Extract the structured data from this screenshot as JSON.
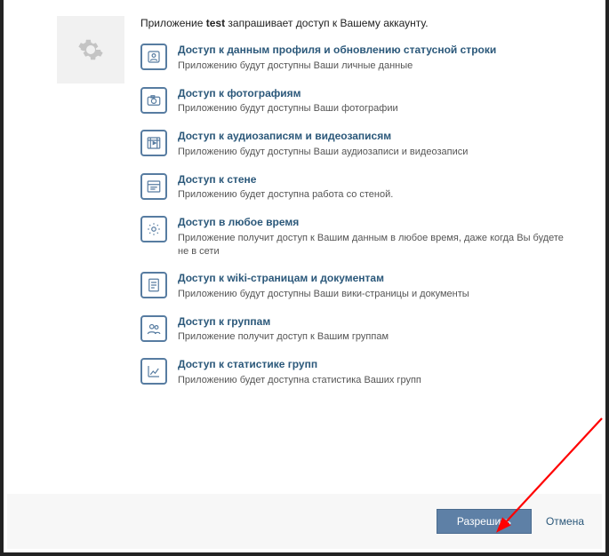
{
  "intro": {
    "prefix": "Приложение ",
    "appname": "test",
    "suffix": " запрашивает доступ к Вашему аккаунту."
  },
  "permissions": [
    {
      "icon": "profile-icon",
      "title": "Доступ к данным профиля и обновлению статусной строки",
      "desc": "Приложению будут доступны Ваши личные данные"
    },
    {
      "icon": "camera-icon",
      "title": "Доступ к фотографиям",
      "desc": "Приложению будут доступны Ваши фотографии"
    },
    {
      "icon": "media-icon",
      "title": "Доступ к аудиозаписям и видеозаписям",
      "desc": "Приложению будут доступны Ваши аудиозаписи и видеозаписи"
    },
    {
      "icon": "wall-icon",
      "title": "Доступ к стене",
      "desc": "Приложению будет доступна работа со стеной."
    },
    {
      "icon": "offline-icon",
      "title": "Доступ в любое время",
      "desc": "Приложение получит доступ к Вашим данным в любое время, даже когда Вы будете не в сети"
    },
    {
      "icon": "docs-icon",
      "title": "Доступ к wiki-страницам и документам",
      "desc": "Приложению будут доступны Ваши вики-страницы и документы"
    },
    {
      "icon": "groups-icon",
      "title": "Доступ к группам",
      "desc": "Приложение получит доступ к Вашим группам"
    },
    {
      "icon": "stats-icon",
      "title": "Доступ к статистике групп",
      "desc": "Приложению будет доступна статистика Ваших групп"
    }
  ],
  "footer": {
    "allow": "Разрешить",
    "cancel": "Отмена"
  }
}
